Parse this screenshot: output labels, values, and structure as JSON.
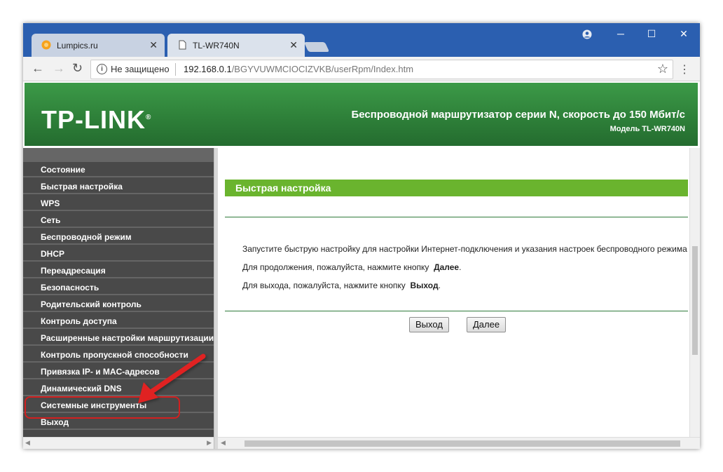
{
  "browser": {
    "tabs": [
      {
        "title": "Lumpics.ru",
        "active": false
      },
      {
        "title": "TL-WR740N",
        "active": true
      }
    ],
    "security_label": "Не защищено",
    "url_host": "192.168.0.1",
    "url_path": "/BGYVUWMCIOCIZVKB/userRpm/Index.htm"
  },
  "banner": {
    "logo": "TP-LINK",
    "logo_mark": "®",
    "subtitle": "Беспроводной маршрутизатор серии N, скорость до 150 Мбит/с",
    "model": "Модель TL-WR740N"
  },
  "sidebar": {
    "items": [
      "Состояние",
      "Быстрая настройка",
      "WPS",
      "Сеть",
      "Беспроводной режим",
      "DHCP",
      "Переадресация",
      "Безопасность",
      "Родительский контроль",
      "Контроль доступа",
      "Расширенные настройки маршрутизации",
      "Контроль пропускной способности",
      "Привязка IP- и MAC-адресов",
      "Динамический DNS",
      "Системные инструменты",
      "Выход"
    ],
    "highlighted": "Системные инструменты"
  },
  "main": {
    "header": "Быстрая настройка",
    "line1": "Запустите быструю настройку для настройки Интернет-подключения и указания настроек беспроводного режима",
    "line2_prefix": "Для продолжения, пожалуйста, нажмите кнопку",
    "line2_bold": "Далее",
    "line3_prefix": "Для выхода, пожалуйста, нажмите кнопку",
    "line3_bold": "Выход",
    "exit_button": "Выход",
    "next_button": "Далее"
  },
  "colors": {
    "banner_green": "#2d7e38",
    "header_green": "#6ab42e",
    "sidebar_bg": "#494949",
    "highlight_red": "#d21f1f"
  }
}
